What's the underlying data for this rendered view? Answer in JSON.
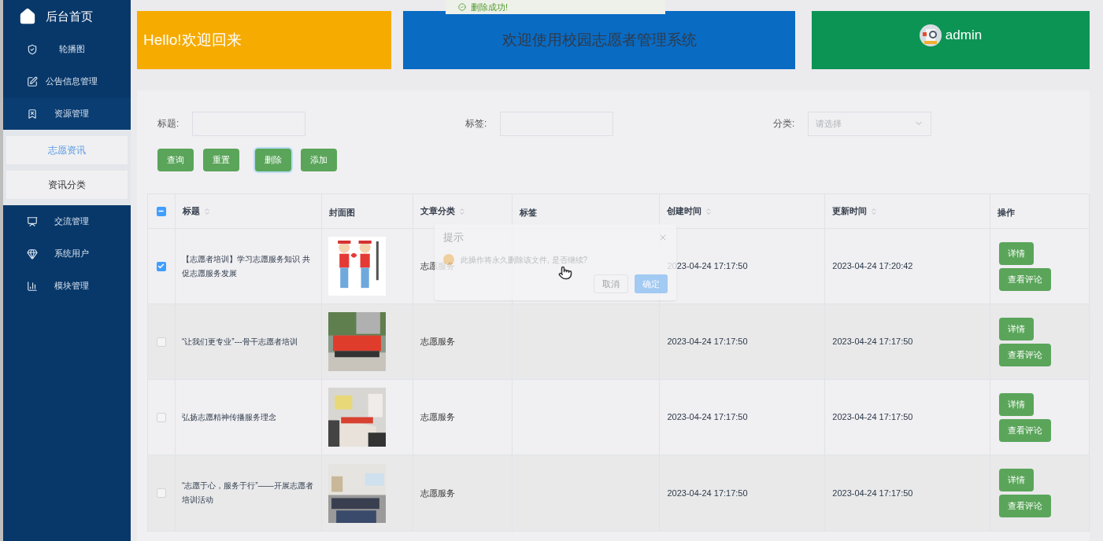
{
  "sidebar": {
    "home": "后台首页",
    "items": [
      {
        "label": "轮播图"
      },
      {
        "label": "公告信息管理"
      },
      {
        "label": "资源管理",
        "expanded": true,
        "children": [
          {
            "label": "志愿资讯",
            "selected": true
          },
          {
            "label": "资讯分类",
            "selected": false
          }
        ]
      },
      {
        "label": "交流管理"
      },
      {
        "label": "系统用户"
      },
      {
        "label": "模块管理"
      }
    ]
  },
  "toast": "删除成功!",
  "header": {
    "greeting": "Hello!欢迎回来",
    "system_title": "欢迎使用校园志愿者管理系统",
    "user": "admin"
  },
  "filters": {
    "title_label": "标题:",
    "tag_label": "标签:",
    "category_label": "分类:",
    "category_placeholder": "请选择"
  },
  "buttons": [
    {
      "label": "查询",
      "focused": false
    },
    {
      "label": "重置",
      "focused": false
    },
    {
      "label": "删除",
      "focused": true
    },
    {
      "label": "添加",
      "focused": false
    }
  ],
  "table": {
    "select_all": {
      "indeterminate": true
    },
    "columns": [
      {
        "label": "标题",
        "sortable": true
      },
      {
        "label": "封面图",
        "sortable": false
      },
      {
        "label": "文章分类",
        "sortable": true
      },
      {
        "label": "标签",
        "sortable": false
      },
      {
        "label": "创建时间",
        "sortable": true
      },
      {
        "label": "更新时间",
        "sortable": true
      },
      {
        "label": "操作",
        "sortable": false
      }
    ],
    "rows": [
      {
        "checked": true,
        "title": "【志愿者培训】学习志愿服务知识 共促志愿服务发展",
        "category": "志愿服务",
        "created": "2023-04-24 17:17:50",
        "updated": "2023-04-24 17:20:42",
        "actions": [
          "详情",
          "查看评论"
        ]
      },
      {
        "checked": false,
        "title": "“让我们更专业”---骨干志愿者培训",
        "category": "志愿服务",
        "created": "2023-04-24 17:17:50",
        "updated": "2023-04-24 17:17:50",
        "actions": [
          "详情",
          "查看评论"
        ]
      },
      {
        "checked": false,
        "title": "弘扬志愿精神传播服务理念",
        "category": "志愿服务",
        "created": "2023-04-24 17:17:50",
        "updated": "2023-04-24 17:17:50",
        "actions": [
          "详情",
          "查看评论"
        ]
      },
      {
        "checked": false,
        "title": "“志愿于心，服务于行”——开展志愿者培训活动",
        "category": "志愿服务",
        "created": "2023-04-24 17:17:50",
        "updated": "2023-04-24 17:17:50",
        "actions": [
          "详情",
          "查看评论"
        ]
      }
    ]
  },
  "dialog": {
    "title": "提示",
    "message": "此操作将永久删除该文件, 是否继续?",
    "buttons": [
      "取消",
      "确定"
    ]
  }
}
